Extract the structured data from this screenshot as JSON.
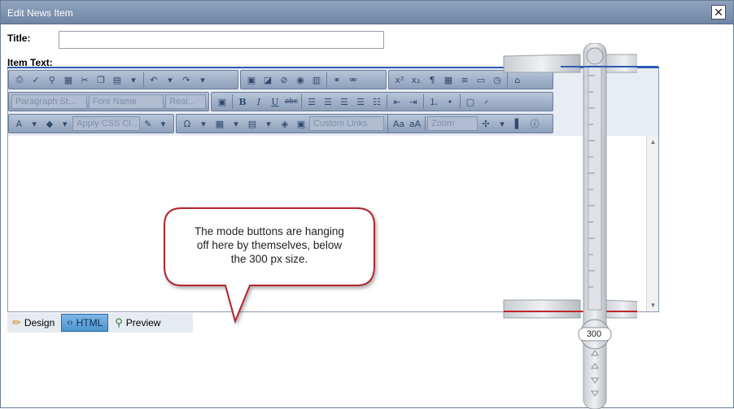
{
  "window": {
    "title": "Edit News Item",
    "close_label": "✕"
  },
  "form": {
    "title_label": "Title:",
    "title_value": "",
    "item_text_label": "Item Text:"
  },
  "toolbar": {
    "paragraph_style": "Paragraph St...",
    "font_name": "Font Name",
    "font_size": "Real...",
    "css_class": "Apply CSS Cl...",
    "custom_links": "Custom Links",
    "zoom": "Zoom"
  },
  "modes": [
    {
      "label": "Design",
      "icon": "pencil-icon"
    },
    {
      "label": "HTML",
      "icon": "html-tag-icon"
    },
    {
      "label": "Preview",
      "icon": "magnifier-icon"
    }
  ],
  "annotation": {
    "line1": "The mode buttons are hanging",
    "line2": "off here by themselves, below",
    "line3": "the 300 px size."
  },
  "ruler": {
    "reading": "300"
  },
  "colors": {
    "titlebar": "#7a90ad",
    "accent": "#2c5bb5",
    "callout_border": "#b0252a",
    "ruler_red": "#c0262b"
  }
}
